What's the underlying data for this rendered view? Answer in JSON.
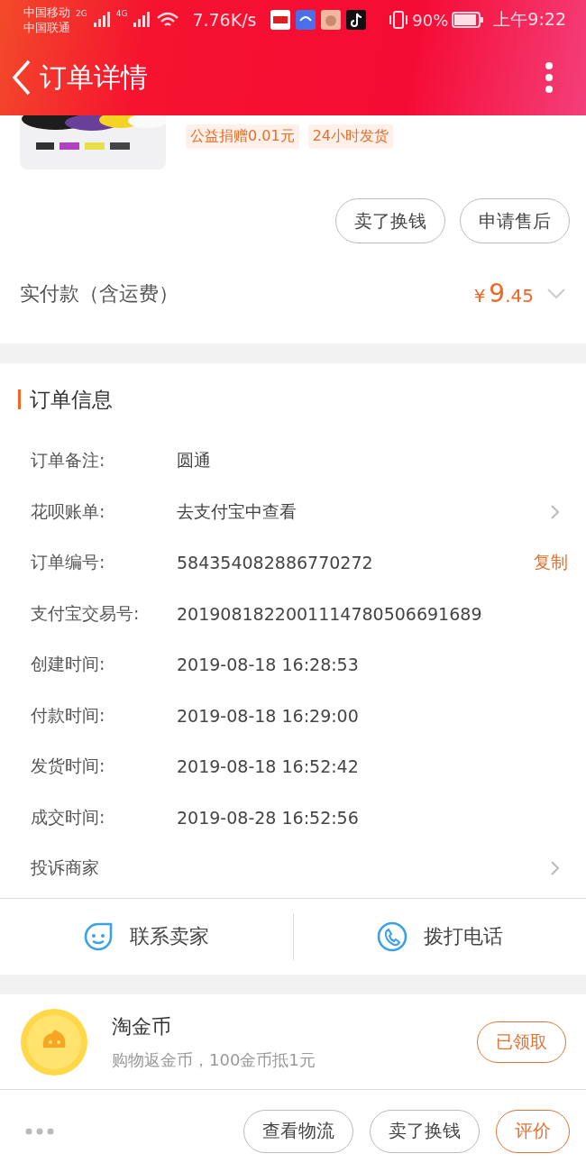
{
  "status_bar": {
    "carriers": [
      "中国移动",
      "中国联通"
    ],
    "net_badges": [
      "2G",
      "4G"
    ],
    "speed": "7.76K/s",
    "battery": "90%",
    "time": "上午9:22"
  },
  "header": {
    "title": "订单详情"
  },
  "product": {
    "image": {
      "kind": "picture"
    },
    "tags": [
      "公益捐赠0.01元",
      "24小时发货"
    ],
    "actions": [
      "卖了换钱",
      "申请售后"
    ]
  },
  "payment": {
    "label": "实付款（含运费）",
    "currency": "¥",
    "amount_integer": "9",
    "amount_decimal": ".45"
  },
  "order_info": {
    "title": "订单信息",
    "rows": [
      {
        "kind": "text",
        "label": "订单备注:",
        "value": "圆通"
      },
      {
        "kind": "link",
        "label": "花呗账单:",
        "value": "去支付宝中查看"
      },
      {
        "kind": "copy",
        "label": "订单编号:",
        "value": "584354082886770272",
        "action": "复制"
      },
      {
        "kind": "text",
        "label": "支付宝交易号:",
        "value": "2019081822001114780506691689"
      },
      {
        "kind": "text",
        "label": "创建时间:",
        "value": "2019-08-18 16:28:53"
      },
      {
        "kind": "text",
        "label": "付款时间:",
        "value": "2019-08-18 16:29:00"
      },
      {
        "kind": "text",
        "label": "发货时间:",
        "value": "2019-08-18 16:52:42"
      },
      {
        "kind": "text",
        "label": "成交时间:",
        "value": "2019-08-28 16:52:56"
      },
      {
        "kind": "link",
        "label": "投诉商家"
      }
    ]
  },
  "contact": [
    {
      "kind": "chat",
      "label": "联系卖家"
    },
    {
      "kind": "phone",
      "label": "拨打电话"
    }
  ],
  "coins": {
    "title": "淘金币",
    "subtitle": "购物返金币，100金币抵1元",
    "button": "已领取"
  },
  "bottom_bar": {
    "buttons": [
      {
        "label": "查看物流",
        "highlight": false
      },
      {
        "label": "卖了换钱",
        "highlight": false
      },
      {
        "label": "评价",
        "highlight": true
      }
    ]
  }
}
